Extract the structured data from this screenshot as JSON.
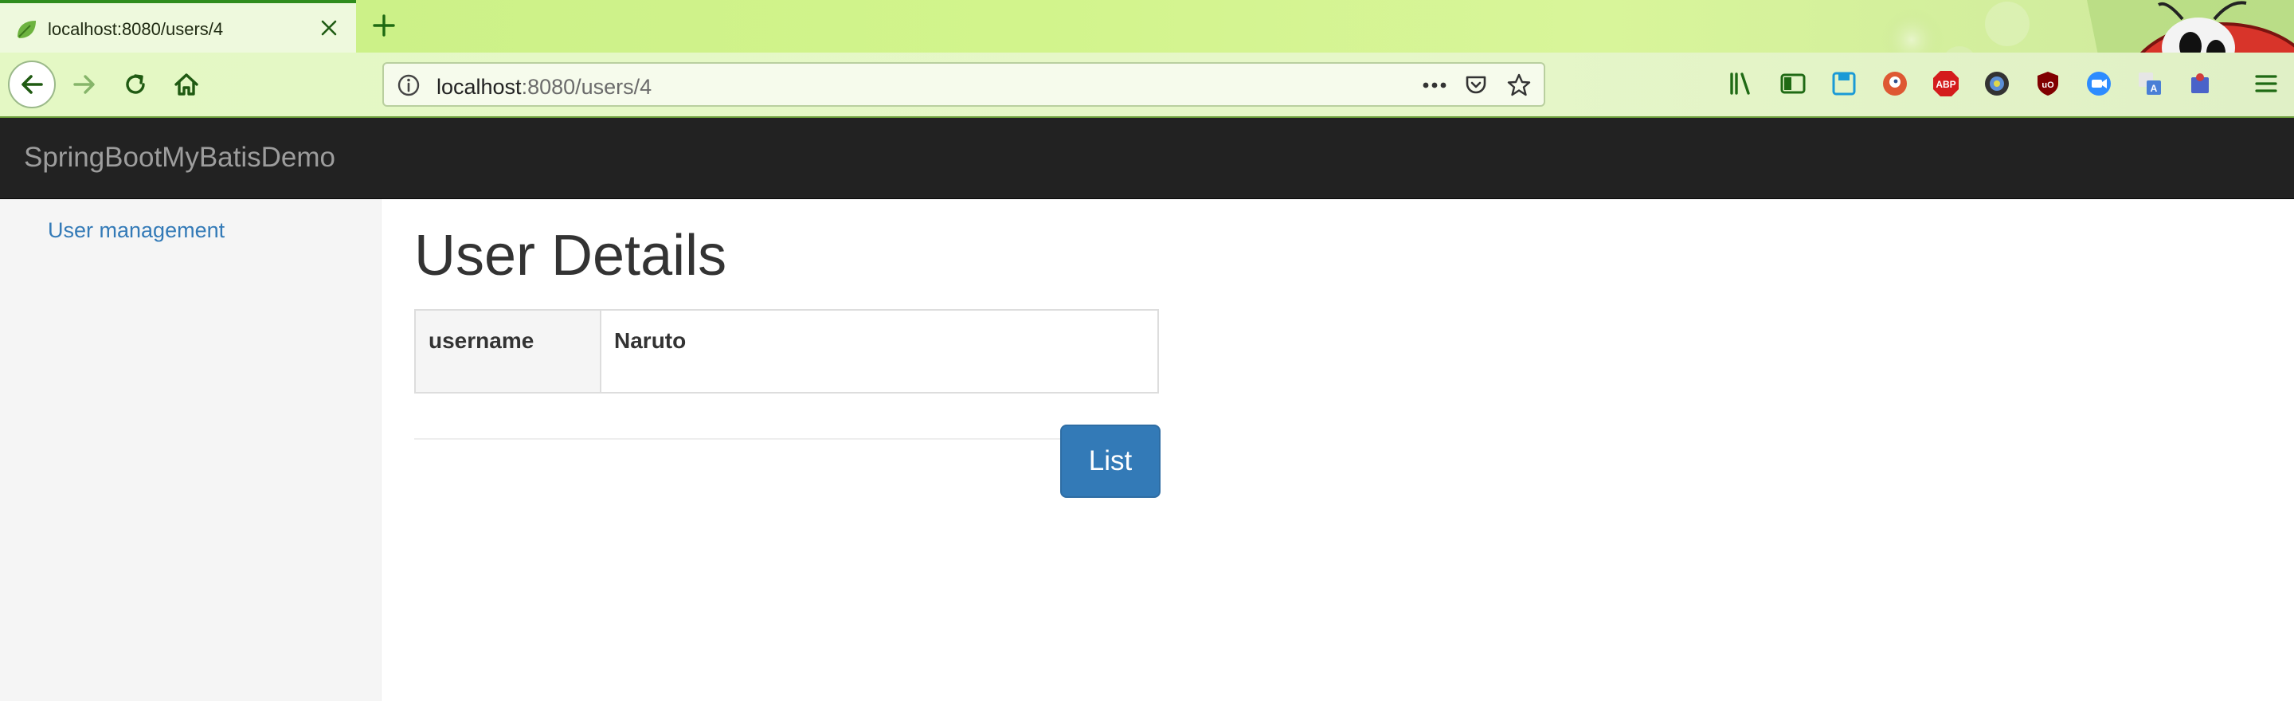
{
  "browser": {
    "tab_title": "localhost:8080/users/4",
    "url_host": "localhost",
    "url_rest": ":8080/users/4",
    "accent_color": "#2f8d1d"
  },
  "toolbar_icons": [
    "library-icon",
    "sidebar-icon",
    "save-icon",
    "duckduckgo-icon",
    "adblock-icon",
    "extension-icon",
    "ublock-icon",
    "zoom-icon",
    "translate-icon",
    "menu-icon"
  ],
  "app": {
    "brand": "SpringBootMyBatisDemo",
    "header_color": "#222222",
    "link_color": "#337ab7"
  },
  "sidebar": {
    "items": [
      {
        "label": "User management"
      }
    ]
  },
  "main": {
    "title": "User Details",
    "details": [
      {
        "label": "username",
        "value": "Naruto"
      }
    ],
    "list_button": "List",
    "button_color": "#337ab7"
  }
}
